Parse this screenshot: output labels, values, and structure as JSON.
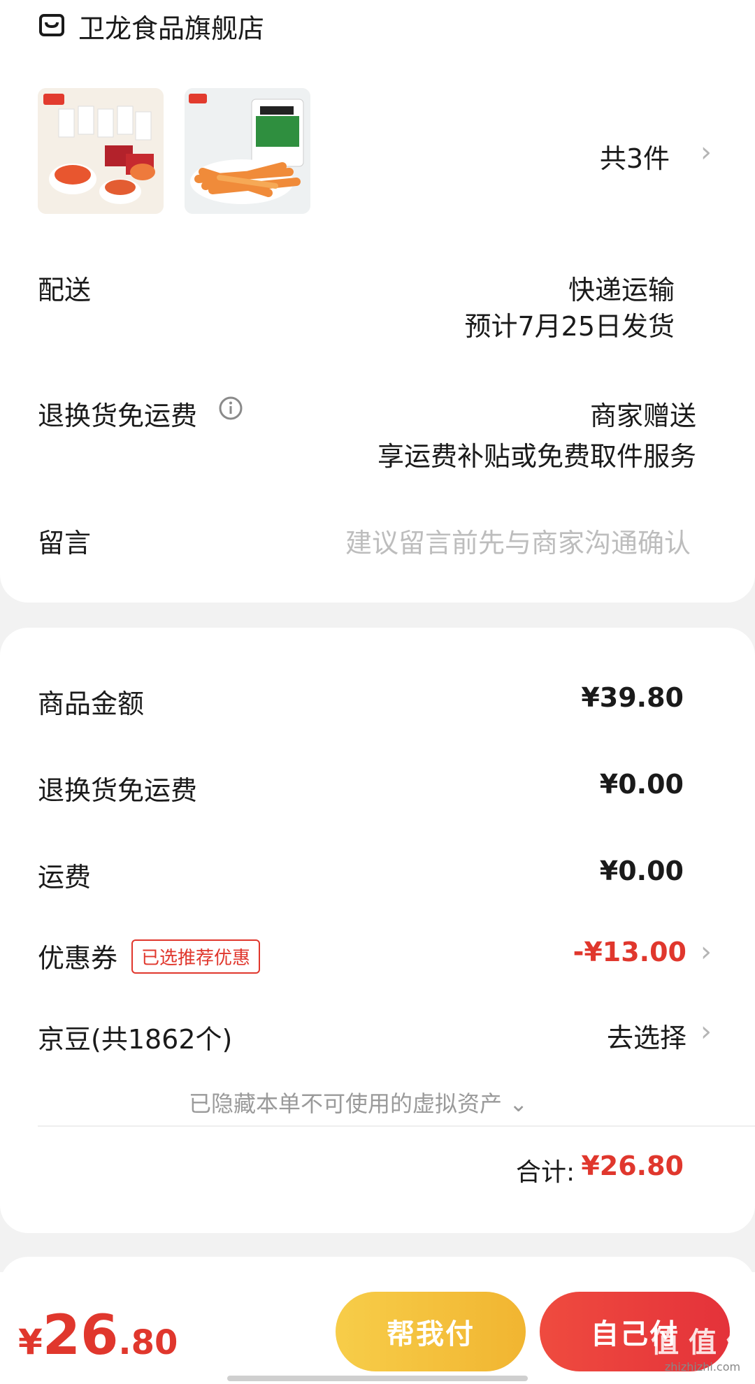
{
  "store": {
    "name": "卫龙食品旗舰店",
    "icon": "store-icon"
  },
  "items": {
    "count_label": "共3件"
  },
  "delivery": {
    "label": "配送",
    "method": "快递运输",
    "estimate": "预计7月25日发货"
  },
  "return_shipping": {
    "label": "退换货免运费",
    "value": "商家赠送",
    "detail": "享运费补贴或免费取件服务",
    "info_icon": "info-icon"
  },
  "message": {
    "label": "留言",
    "placeholder": "建议留言前先与商家沟通确认"
  },
  "price": {
    "goods_label": "商品金额",
    "goods_value": "¥39.80",
    "return_label": "退换货免运费",
    "return_value": "¥0.00",
    "shipping_label": "运费",
    "shipping_value": "¥0.00",
    "coupon_label": "优惠券",
    "coupon_tag": "已选推荐优惠",
    "coupon_value": "-¥13.00",
    "beans_label": "京豆(共1862个)",
    "beans_action": "去选择",
    "hidden_assets": "已隐藏本单不可使用的虚拟资产",
    "total_label": "合计:",
    "total_value": "¥26.80"
  },
  "footer": {
    "currency": "¥",
    "amount_int": "26",
    "amount_dec": ".80",
    "help_pay": "帮我付",
    "self_pay": "自己付",
    "watermark": "值 值 值",
    "watermark_sub": "zhizhizhi.com"
  },
  "colors": {
    "accent_red": "#e0372d",
    "help_pay_bg": "#f4c33e",
    "self_pay_bg": "#e63a36"
  }
}
